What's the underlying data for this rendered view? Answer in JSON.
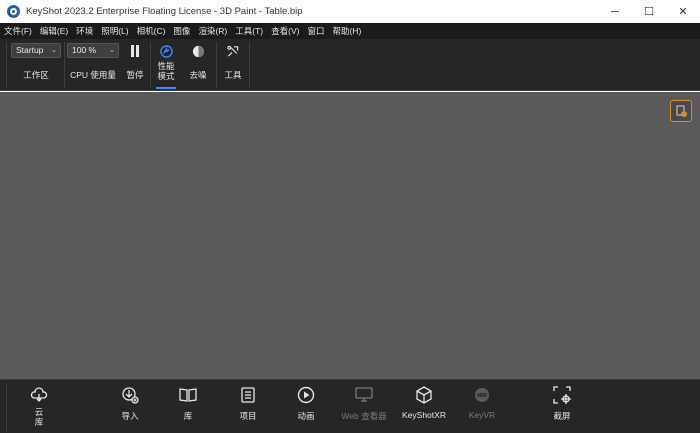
{
  "window": {
    "title": "KeyShot 2023.2 Enterprise Floating License  - 3D Paint - Table.bip",
    "min_glyph": "─",
    "max_glyph": "☐",
    "close_glyph": "✕"
  },
  "menu": [
    "文件(F)",
    "编辑(E)",
    "环境",
    "照明(L)",
    "相机(C)",
    "图像",
    "渲染(R)",
    "工具(T)",
    "查看(V)",
    "窗口",
    "帮助(H)"
  ],
  "toolbar": {
    "workspace_value": "Startup",
    "workspace_label": "工作区",
    "cpu_value": "100 %",
    "cpu_label": "CPU 使用量",
    "pause_label": "暂停",
    "perf_label_line1": "性能",
    "perf_label_line2": "模式",
    "denoise_label": "去噪",
    "tools_label": "工具",
    "chevron": "⌄"
  },
  "ribbon": {
    "cloud_line1": "云",
    "cloud_line2": "库",
    "import": "导入",
    "library": "库",
    "project": "项目",
    "animation": "动画",
    "web_viewer": "Web 查看器",
    "keyshotxr": "KeyShotXR",
    "keyvr": "KeyVR",
    "screenshot": "截屏"
  },
  "colors": {
    "accent": "#3a8cff",
    "viewport_bg": "#5a5a5a",
    "toolbar_bg": "#262626",
    "menu_bg": "#1b1b1b",
    "orange_warning": "#d68a2a"
  }
}
